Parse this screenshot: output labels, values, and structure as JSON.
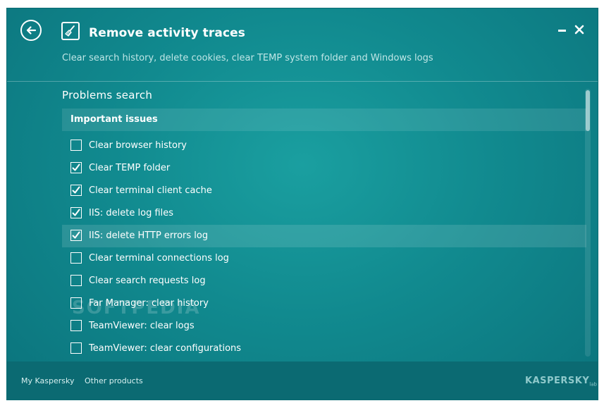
{
  "header": {
    "title": "Remove activity traces",
    "subtitle": "Clear search history, delete cookies, clear TEMP system folder and Windows logs"
  },
  "icons": {
    "back": "arrow-left-circle-icon",
    "title": "broom-icon",
    "minimize": "minimize-icon",
    "close": "close-icon"
  },
  "content": {
    "section_title": "Problems search",
    "group_title": "Important issues",
    "items": [
      {
        "label": "Clear browser history",
        "checked": false
      },
      {
        "label": "Clear TEMP folder",
        "checked": true
      },
      {
        "label": "Clear terminal client cache",
        "checked": true
      },
      {
        "label": "IIS: delete log files",
        "checked": true
      },
      {
        "label": "IIS: delete HTTP errors log",
        "checked": true
      },
      {
        "label": "Clear terminal connections log",
        "checked": false
      },
      {
        "label": "Clear search requests log",
        "checked": false
      },
      {
        "label": "Far Manager: clear history",
        "checked": false
      },
      {
        "label": "TeamViewer: clear logs",
        "checked": false
      },
      {
        "label": "TeamViewer: clear configurations",
        "checked": false
      }
    ]
  },
  "footer": {
    "link_my": "My Kaspersky",
    "link_other": "Other products",
    "brand": "KASPERSKY",
    "brand_suffix": "lab"
  },
  "watermark": "SOFTPEDIA",
  "colors": {
    "background": "#118a8f",
    "footer": "#0b6a72",
    "text": "#ffffff"
  }
}
